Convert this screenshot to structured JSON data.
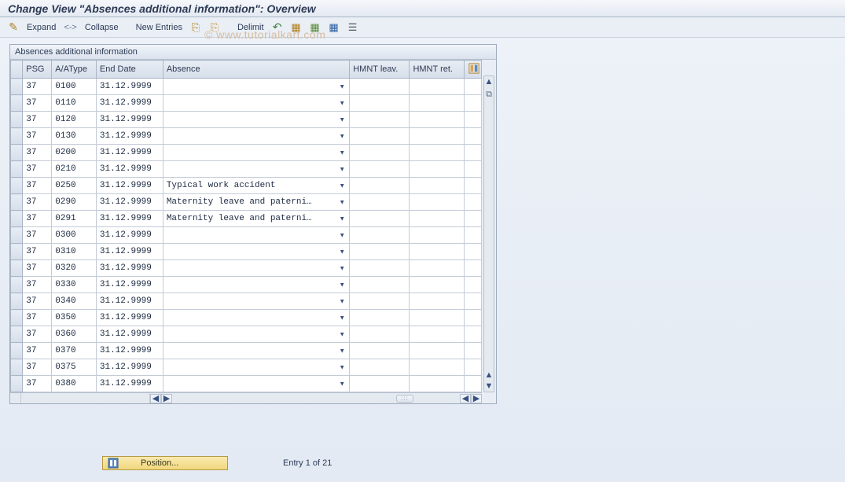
{
  "title": "Change View \"Absences additional information\": Overview",
  "toolbar": {
    "expand_label": "Expand",
    "collapse_label": "Collapse",
    "sep": "<->",
    "new_entries_label": "New Entries",
    "delimit_label": "Delimit"
  },
  "panel_title": "Absences additional information",
  "columns": {
    "handle": "",
    "psg": "PSG",
    "aatype": "A/AType",
    "end_date": "End Date",
    "absence": "Absence",
    "hmnt_leav": "HMNT leav.",
    "hmnt_ret": "HMNT ret."
  },
  "rows": [
    {
      "psg": "37",
      "aatype": "0100",
      "end_date": "31.12.9999",
      "absence": "",
      "hmnt_leav": "",
      "hmnt_ret": ""
    },
    {
      "psg": "37",
      "aatype": "0110",
      "end_date": "31.12.9999",
      "absence": "",
      "hmnt_leav": "",
      "hmnt_ret": ""
    },
    {
      "psg": "37",
      "aatype": "0120",
      "end_date": "31.12.9999",
      "absence": "",
      "hmnt_leav": "",
      "hmnt_ret": ""
    },
    {
      "psg": "37",
      "aatype": "0130",
      "end_date": "31.12.9999",
      "absence": "",
      "hmnt_leav": "",
      "hmnt_ret": ""
    },
    {
      "psg": "37",
      "aatype": "0200",
      "end_date": "31.12.9999",
      "absence": "",
      "hmnt_leav": "",
      "hmnt_ret": ""
    },
    {
      "psg": "37",
      "aatype": "0210",
      "end_date": "31.12.9999",
      "absence": "",
      "hmnt_leav": "",
      "hmnt_ret": ""
    },
    {
      "psg": "37",
      "aatype": "0250",
      "end_date": "31.12.9999",
      "absence": "Typical work accident",
      "hmnt_leav": "",
      "hmnt_ret": ""
    },
    {
      "psg": "37",
      "aatype": "0290",
      "end_date": "31.12.9999",
      "absence": "Maternity leave and paterni…",
      "hmnt_leav": "",
      "hmnt_ret": ""
    },
    {
      "psg": "37",
      "aatype": "0291",
      "end_date": "31.12.9999",
      "absence": "Maternity leave and paterni…",
      "hmnt_leav": "",
      "hmnt_ret": ""
    },
    {
      "psg": "37",
      "aatype": "0300",
      "end_date": "31.12.9999",
      "absence": "",
      "hmnt_leav": "",
      "hmnt_ret": ""
    },
    {
      "psg": "37",
      "aatype": "0310",
      "end_date": "31.12.9999",
      "absence": "",
      "hmnt_leav": "",
      "hmnt_ret": ""
    },
    {
      "psg": "37",
      "aatype": "0320",
      "end_date": "31.12.9999",
      "absence": "",
      "hmnt_leav": "",
      "hmnt_ret": ""
    },
    {
      "psg": "37",
      "aatype": "0330",
      "end_date": "31.12.9999",
      "absence": "",
      "hmnt_leav": "",
      "hmnt_ret": ""
    },
    {
      "psg": "37",
      "aatype": "0340",
      "end_date": "31.12.9999",
      "absence": "",
      "hmnt_leav": "",
      "hmnt_ret": ""
    },
    {
      "psg": "37",
      "aatype": "0350",
      "end_date": "31.12.9999",
      "absence": "",
      "hmnt_leav": "",
      "hmnt_ret": ""
    },
    {
      "psg": "37",
      "aatype": "0360",
      "end_date": "31.12.9999",
      "absence": "",
      "hmnt_leav": "",
      "hmnt_ret": ""
    },
    {
      "psg": "37",
      "aatype": "0370",
      "end_date": "31.12.9999",
      "absence": "",
      "hmnt_leav": "",
      "hmnt_ret": ""
    },
    {
      "psg": "37",
      "aatype": "0375",
      "end_date": "31.12.9999",
      "absence": "",
      "hmnt_leav": "",
      "hmnt_ret": ""
    },
    {
      "psg": "37",
      "aatype": "0380",
      "end_date": "31.12.9999",
      "absence": "",
      "hmnt_leav": "",
      "hmnt_ret": ""
    }
  ],
  "footer": {
    "position_label": "Position...",
    "entry_label": "Entry 1 of 21"
  },
  "ghost_text": "© www.tutorialkart.com"
}
